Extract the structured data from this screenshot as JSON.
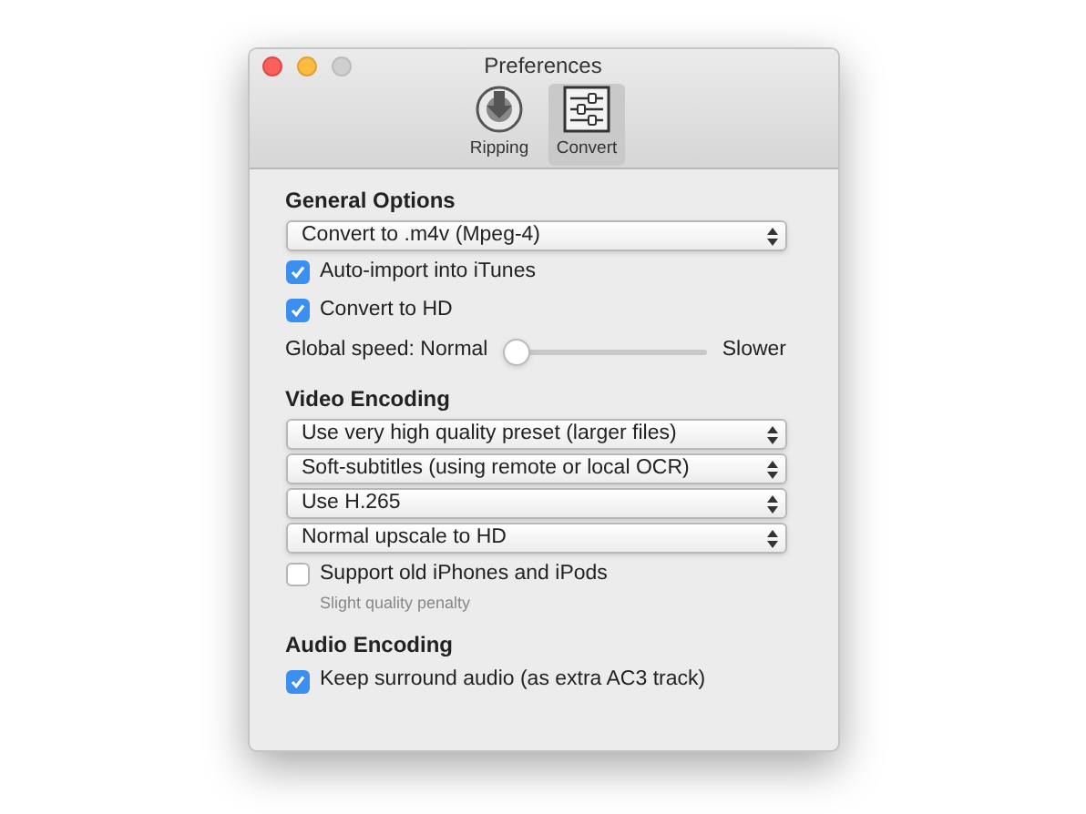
{
  "window": {
    "title": "Preferences"
  },
  "tabs": [
    {
      "label": "Ripping",
      "kind": "disc",
      "selected": false
    },
    {
      "label": "Convert",
      "kind": "sliders",
      "selected": true
    }
  ],
  "sections": [
    {
      "heading": "General Options",
      "items": [
        {
          "kind": "popup",
          "value": "Convert to .m4v (Mpeg-4)"
        },
        {
          "kind": "checkbox",
          "label": "Auto-import into iTunes",
          "checked": true
        },
        {
          "kind": "checkbox",
          "label": "Convert to HD",
          "checked": true
        },
        {
          "kind": "slider",
          "label": "Global speed: Normal",
          "end_label": "Slower",
          "level": 0
        }
      ]
    },
    {
      "heading": "Video Encoding",
      "items": [
        {
          "kind": "popup",
          "value": "Use very high quality preset (larger files)"
        },
        {
          "kind": "popup",
          "value": "Soft-subtitles (using remote or local OCR)"
        },
        {
          "kind": "popup",
          "value": "Use H.265"
        },
        {
          "kind": "popup",
          "value": "Normal upscale to HD"
        },
        {
          "kind": "checkbox",
          "label": "Support old iPhones and iPods",
          "checked": false,
          "note": "Slight quality penalty"
        }
      ]
    },
    {
      "heading": "Audio Encoding",
      "items": [
        {
          "kind": "checkbox",
          "label": "Keep surround audio (as extra AC3 track)",
          "checked": true
        }
      ]
    }
  ]
}
